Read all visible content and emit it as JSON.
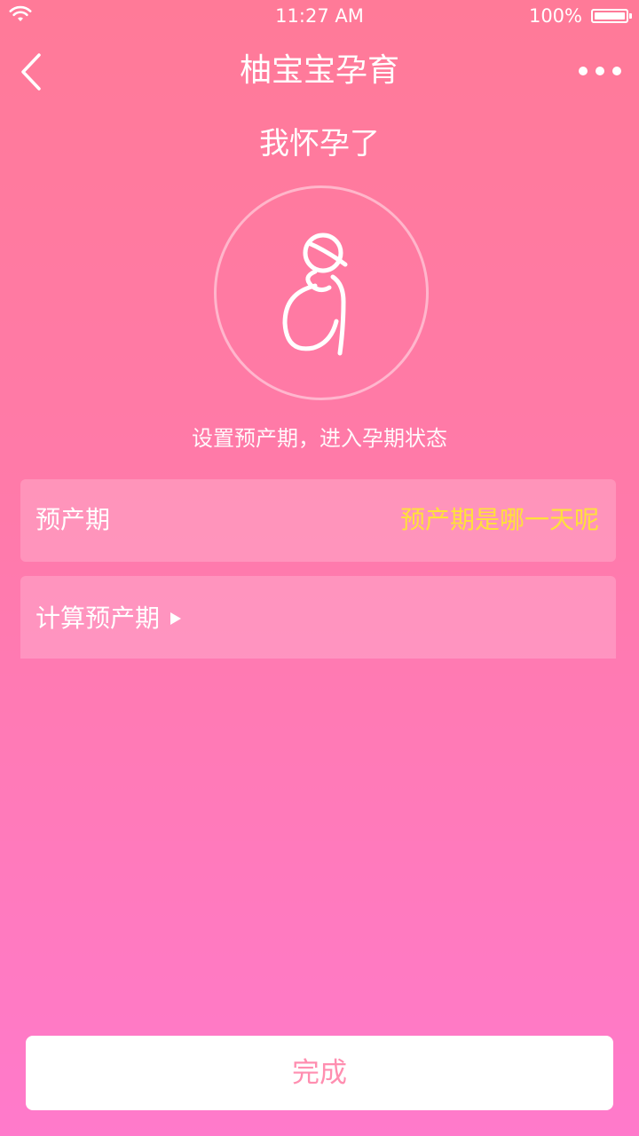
{
  "status_bar": {
    "time": "11:27 AM",
    "battery": "100%",
    "icons": [
      "wifi-icon",
      "battery-icon"
    ]
  },
  "nav": {
    "title": "柚宝宝孕育",
    "back_icon": "chevron-left-icon",
    "more_icon": "more-dots-icon"
  },
  "page": {
    "heading": "我怀孕了",
    "illustration_icon": "pregnant-woman-icon",
    "subtitle": "设置预产期，进入孕期状态"
  },
  "due_date": {
    "label": "预产期",
    "placeholder": "预产期是哪一天呢"
  },
  "calculate": {
    "label": "计算预产期",
    "icon": "play-arrow-icon"
  },
  "done_button": {
    "label": "完成"
  },
  "colors": {
    "gradient_top": "#ff7a98",
    "gradient_bottom": "#ff7acb",
    "accent_yellow": "#ffe13a",
    "button_text": "#ff8eb0"
  }
}
